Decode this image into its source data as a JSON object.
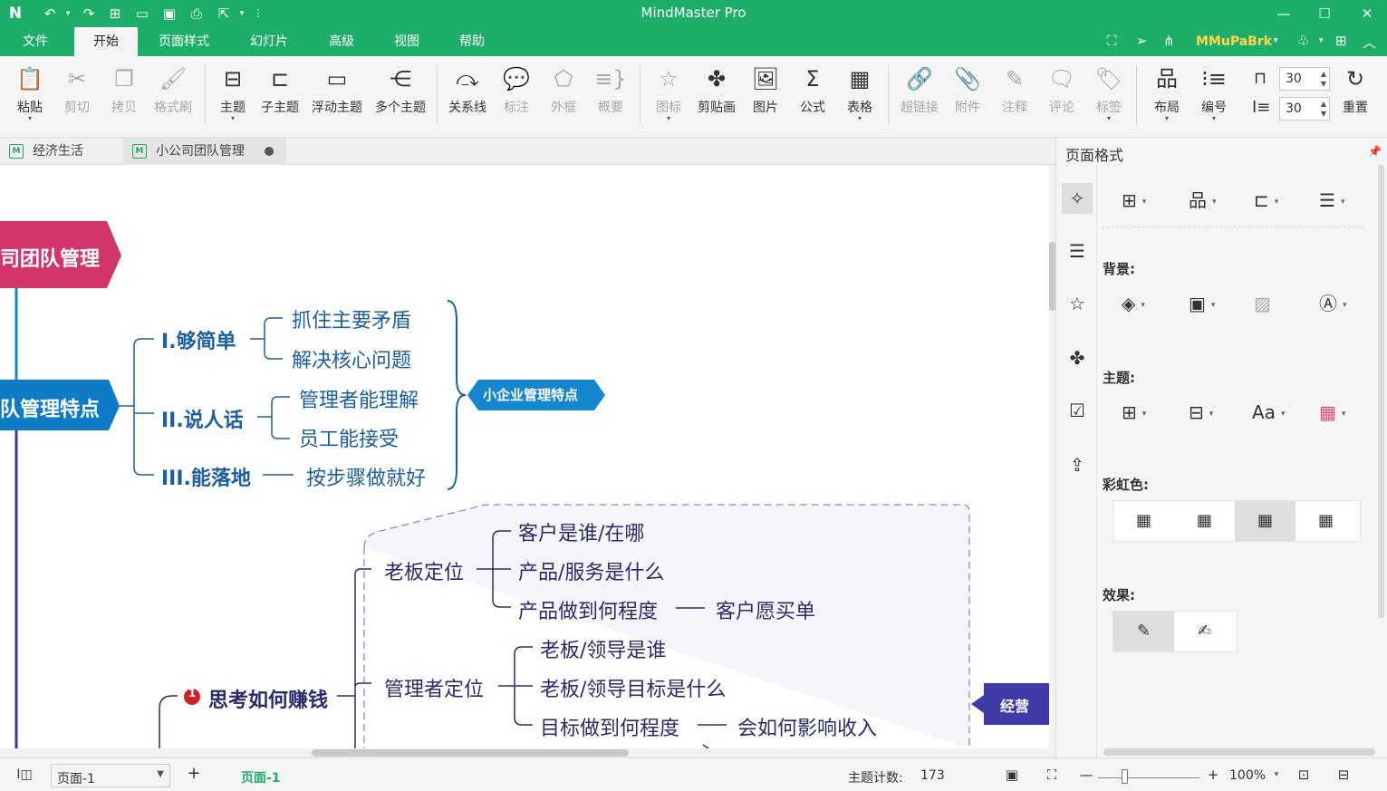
{
  "app": {
    "title": "MindMaster Pro",
    "user": "MMuPaBrk",
    "quick_access_icons": [
      "app-logo-icon",
      "undo-icon",
      "redo-icon",
      "new-icon",
      "open-icon",
      "save-icon",
      "print-icon",
      "export-icon",
      "customize-icon"
    ],
    "window_controls": [
      "minimize-icon",
      "maximize-icon",
      "close-icon"
    ]
  },
  "menu": {
    "items": [
      "文件",
      "开始",
      "页面样式",
      "幻灯片",
      "高级",
      "视图",
      "帮助"
    ],
    "active": "开始"
  },
  "ribbon": {
    "clipboard": [
      "粘贴",
      "剪切",
      "拷贝",
      "格式刷"
    ],
    "insert": [
      "主题",
      "子主题",
      "浮动主题",
      "多个主题"
    ],
    "relation": [
      "关系线",
      "标注",
      "外框",
      "概要"
    ],
    "media": [
      "图标",
      "剪贴画",
      "图片",
      "公式",
      "表格"
    ],
    "attach": [
      "超链接",
      "附件",
      "注释",
      "评论",
      "标签"
    ],
    "layout": [
      "布局",
      "编号"
    ],
    "spacing_h": "30",
    "spacing_v": "30",
    "reset": "重置"
  },
  "doc_tabs": [
    "经济生活",
    "小公司团队管理"
  ],
  "mindmap": {
    "root": "司团队管理",
    "topic1": "队管理特点",
    "branch_a": {
      "label": "I.够简单",
      "children": [
        "抓住主要矛盾",
        "解决核心问题"
      ]
    },
    "branch_b": {
      "label": "II.说人话",
      "children": [
        "管理者能理解",
        "员工能接受"
      ]
    },
    "branch_c": {
      "label": "III.能落地",
      "children": [
        "按步骤做就好"
      ]
    },
    "summary1": "小企业管理特点",
    "topic2": "思考如何赚钱",
    "topic2_marker": "1",
    "boss": {
      "label": "老板定位",
      "children": [
        "客户是谁/在哪",
        "产品/服务是什么",
        "产品做到何程度"
      ],
      "extra": "客户愿买单"
    },
    "manager": {
      "label": "管理者定位",
      "children": [
        "老板/领导是谁",
        "老板/领导目标是什么",
        "目标做到何程度"
      ],
      "extra": "会如何影响收入"
    },
    "callout2": "经营",
    "colors": {
      "root": "#d23669",
      "topic1": "#0e7bc6",
      "summary": "#1487d0",
      "callout": "#3e3aa8",
      "line_blue": "#1b5fa0",
      "boundary": "#8a86d8"
    }
  },
  "panel": {
    "title": "页面格式",
    "sections": {
      "background": "背景:",
      "theme": "主题:",
      "rainbow": "彩虹色:",
      "effects": "效果:"
    }
  },
  "status": {
    "page_select": "页面-1",
    "page_tab": "页面-1",
    "topic_count_label": "主题计数:",
    "topic_count": "173",
    "zoom": "100%"
  }
}
